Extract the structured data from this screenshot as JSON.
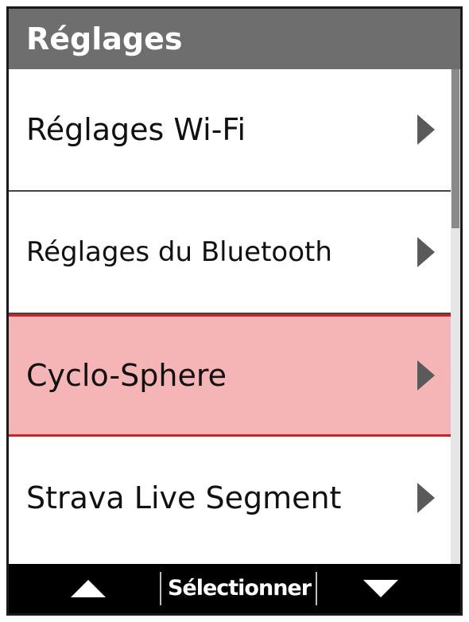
{
  "header": {
    "title": "Réglages"
  },
  "menu": {
    "items": [
      {
        "label": "Réglages Wi-Fi",
        "selected": false,
        "icon": "chevron-right-icon"
      },
      {
        "label": "Réglages du Bluetooth",
        "selected": false,
        "icon": "chevron-right-icon"
      },
      {
        "label": "Cyclo-Sphere",
        "selected": true,
        "icon": "chevron-right-icon"
      },
      {
        "label": "Strava Live Segment",
        "selected": false,
        "icon": "chevron-right-icon"
      }
    ]
  },
  "footer": {
    "up_icon": "triangle-up-icon",
    "select_label": "Sélectionner",
    "down_icon": "triangle-down-icon"
  },
  "colors": {
    "header_bg": "#6e6e6e",
    "selected_bg": "#f5b5b7",
    "selected_border": "#c9222a",
    "footer_bg": "#000000"
  }
}
